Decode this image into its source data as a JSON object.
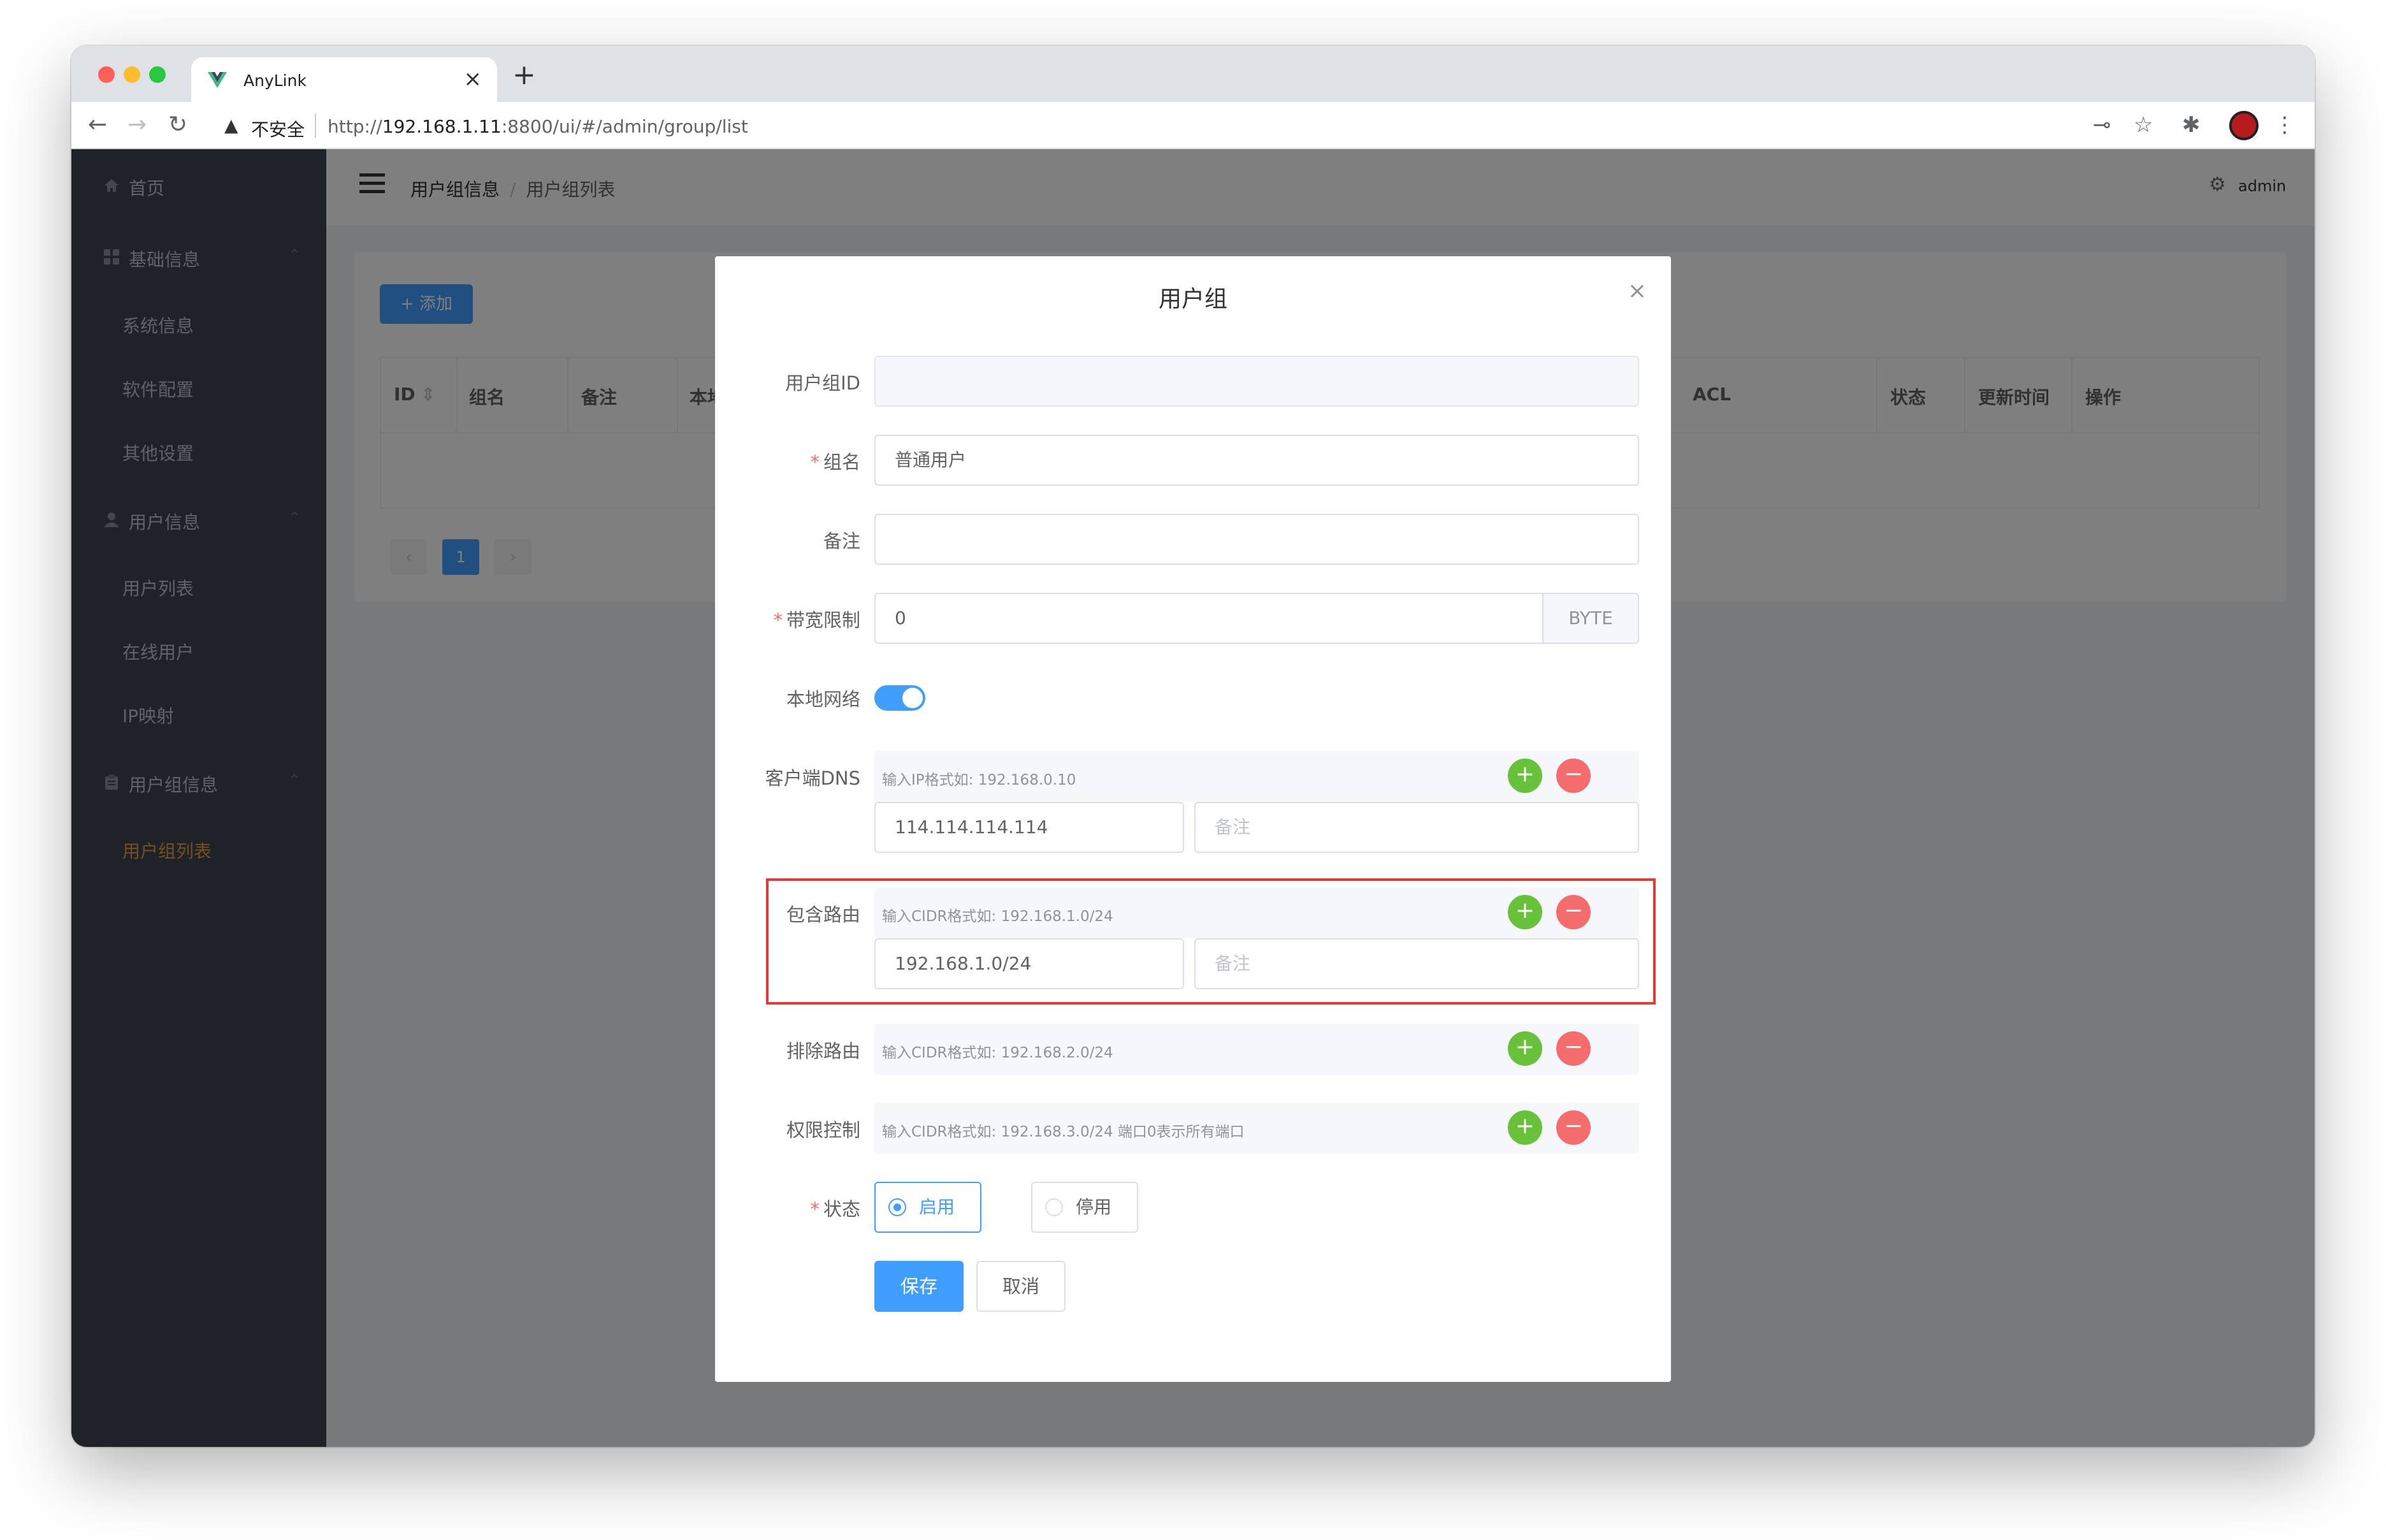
{
  "browser": {
    "tab_title": "AnyLink",
    "tab_close": "×",
    "new_tab": "+",
    "back": "←",
    "forward": "→",
    "reload": "↻",
    "warning": "▲",
    "insecure": "不安全",
    "url_prefix": "http://",
    "url_host": "192.168.1.11",
    "url_rest": ":8800/ui/#/admin/group/list",
    "key_icon": "⊸",
    "star_icon": "☆",
    "ext_icon": "✱",
    "menu_icon": "⋮",
    "colors": {
      "close": "#ff5f57",
      "minimize": "#febc2e",
      "maximize": "#28c840"
    }
  },
  "sidebar": {
    "home": "首页",
    "basic": "基础信息",
    "system_info": "系统信息",
    "software_config": "软件配置",
    "other_settings": "其他设置",
    "user_info": "用户信息",
    "user_list": "用户列表",
    "online_users": "在线用户",
    "ip_map": "IP映射",
    "group_info": "用户组信息",
    "group_list": "用户组列表",
    "chevron": "⌃",
    "active_color": "#e6a23c"
  },
  "header": {
    "crumb1": "用户组信息",
    "crumb_sep": "/",
    "crumb2": "用户组列表",
    "gear": "⚙",
    "user": "admin"
  },
  "list": {
    "add_label": "+ 添加",
    "columns": [
      "ID",
      "组名",
      "备注",
      "本地",
      "ACL",
      "状态",
      "更新时间",
      "操作"
    ],
    "sort": "⇕",
    "prev": "‹",
    "page": "1",
    "next": "›"
  },
  "dialog": {
    "title": "用户组",
    "close": "×",
    "required_mark": "*",
    "group_id_label": "用户组ID",
    "group_id_value": "",
    "name_label": "组名",
    "name_value": "普通用户",
    "note_label": "备注",
    "note_value": "",
    "bandwidth_label": "带宽限制",
    "bandwidth_value": "0",
    "bandwidth_unit": "BYTE",
    "local_net_label": "本地网络",
    "local_net_on": true,
    "dns_label": "客户端DNS",
    "dns_hint": "输入IP格式如: 192.168.0.10",
    "dns_value": "114.114.114.114",
    "dns_note_placeholder": "备注",
    "include_label": "包含路由",
    "include_hint": "输入CIDR格式如: 192.168.1.0/24",
    "include_value": "192.168.1.0/24",
    "include_note_placeholder": "备注",
    "exclude_label": "排除路由",
    "exclude_hint": "输入CIDR格式如: 192.168.2.0/24",
    "acl_label": "权限控制",
    "acl_hint": "输入CIDR格式如: 192.168.3.0/24 端口0表示所有端口",
    "plus": "+",
    "minus": "−",
    "status_label": "状态",
    "enable": "启用",
    "disable": "停用",
    "status_value": "启用",
    "save": "保存",
    "cancel": "取消",
    "accent": "#409eff",
    "add_color": "#67c23a",
    "remove_color": "#f56c6c",
    "highlight_color": "#e53935"
  }
}
